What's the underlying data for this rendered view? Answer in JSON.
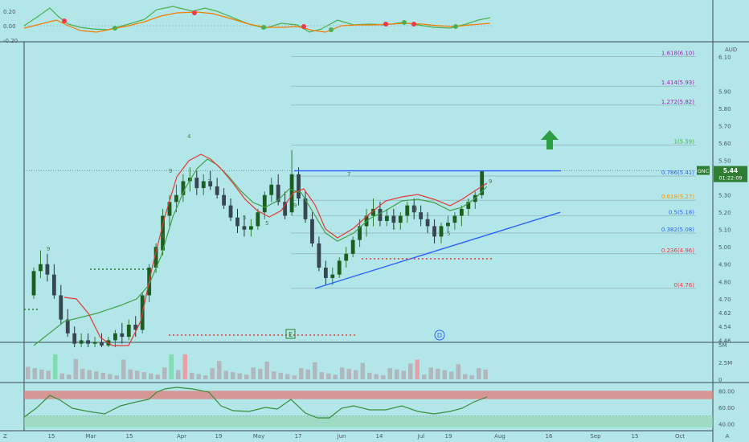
{
  "chart_data": {
    "type": "candlestick",
    "symbol": "GNC",
    "currency": "AUD",
    "last_price": "5.44",
    "countdown": "01:22:09",
    "x_ticks": [
      "15",
      "Mar",
      "15",
      "Apr",
      "19",
      "May",
      "17",
      "Jun",
      "14",
      "Jul",
      "19",
      "Aug",
      "16",
      "Sep",
      "15",
      "Oct",
      "A"
    ],
    "price_axis": {
      "ticks": [
        "6.10",
        "5.90",
        "5.80",
        "5.70",
        "5.60",
        "5.50",
        "5.40",
        "5.30",
        "5.20",
        "5.10",
        "5.00",
        "4.90",
        "4.80",
        "4.70",
        "4.62",
        "4.54",
        "4.46"
      ],
      "ylim": [
        4.42,
        6.14
      ],
      "unit": "AUD"
    },
    "fibonacci": [
      {
        "label": "1.618(6.10)",
        "price": 6.1,
        "color": "#9c27b0"
      },
      {
        "label": "1.414(5.93)",
        "price": 5.93,
        "color": "#9c27b0"
      },
      {
        "label": "1.272(5.82)",
        "price": 5.82,
        "color": "#9c27b0"
      },
      {
        "label": "1(5.59)",
        "price": 5.59,
        "color": "#4caf50"
      },
      {
        "label": "0.786(5.41)",
        "price": 5.41,
        "color": "#2962ff"
      },
      {
        "label": "0.618(5.27)",
        "price": 5.27,
        "color": "#ff9800"
      },
      {
        "label": "0.5(5.18)",
        "price": 5.18,
        "color": "#2962ff"
      },
      {
        "label": "0.382(5.08)",
        "price": 5.08,
        "color": "#2962ff"
      },
      {
        "label": "0.236(4.96)",
        "price": 4.96,
        "color": "#f23645"
      },
      {
        "label": "0(4.76)",
        "price": 4.76,
        "color": "#f23645"
      }
    ],
    "candles": [
      [
        4.72,
        4.88,
        4.7,
        4.86
      ],
      [
        4.86,
        4.98,
        4.82,
        4.9
      ],
      [
        4.9,
        4.96,
        4.8,
        4.84
      ],
      [
        4.84,
        4.9,
        4.7,
        4.72
      ],
      [
        4.72,
        4.78,
        4.55,
        4.58
      ],
      [
        4.58,
        4.64,
        4.48,
        4.5
      ],
      [
        4.5,
        4.54,
        4.42,
        4.44
      ],
      [
        4.44,
        4.5,
        4.42,
        4.46
      ],
      [
        4.46,
        4.5,
        4.42,
        4.44
      ],
      [
        4.44,
        4.48,
        4.42,
        4.45
      ],
      [
        4.45,
        4.5,
        4.42,
        4.43
      ],
      [
        4.43,
        4.48,
        4.42,
        4.46
      ],
      [
        4.46,
        4.52,
        4.42,
        4.5
      ],
      [
        4.5,
        4.56,
        4.44,
        4.48
      ],
      [
        4.48,
        4.58,
        4.46,
        4.55
      ],
      [
        4.55,
        4.6,
        4.48,
        4.52
      ],
      [
        4.52,
        4.74,
        4.5,
        4.72
      ],
      [
        4.72,
        4.9,
        4.68,
        4.88
      ],
      [
        4.88,
        5.02,
        4.85,
        5.0
      ],
      [
        4.98,
        5.22,
        4.95,
        5.18
      ],
      [
        5.18,
        5.3,
        5.12,
        5.26
      ],
      [
        5.26,
        5.36,
        5.2,
        5.3
      ],
      [
        5.3,
        5.42,
        5.26,
        5.38
      ],
      [
        5.38,
        5.46,
        5.32,
        5.4
      ],
      [
        5.4,
        5.44,
        5.3,
        5.34
      ],
      [
        5.34,
        5.42,
        5.3,
        5.38
      ],
      [
        5.38,
        5.44,
        5.33,
        5.35
      ],
      [
        5.35,
        5.4,
        5.28,
        5.3
      ],
      [
        5.3,
        5.34,
        5.22,
        5.24
      ],
      [
        5.24,
        5.28,
        5.15,
        5.17
      ],
      [
        5.17,
        5.22,
        5.08,
        5.12
      ],
      [
        5.12,
        5.18,
        5.06,
        5.1
      ],
      [
        5.1,
        5.16,
        5.06,
        5.12
      ],
      [
        5.12,
        5.22,
        5.1,
        5.2
      ],
      [
        5.2,
        5.32,
        5.16,
        5.3
      ],
      [
        5.3,
        5.4,
        5.26,
        5.36
      ],
      [
        5.36,
        5.42,
        5.24,
        5.26
      ],
      [
        5.26,
        5.32,
        5.16,
        5.18
      ],
      [
        5.2,
        5.56,
        5.18,
        5.42
      ],
      [
        5.42,
        5.46,
        5.24,
        5.28
      ],
      [
        5.28,
        5.32,
        5.14,
        5.16
      ],
      [
        5.16,
        5.2,
        5.0,
        5.02
      ],
      [
        5.02,
        5.06,
        4.86,
        4.88
      ],
      [
        4.88,
        4.92,
        4.78,
        4.82
      ],
      [
        4.82,
        4.88,
        4.78,
        4.84
      ],
      [
        4.84,
        4.94,
        4.82,
        4.92
      ],
      [
        4.92,
        5.0,
        4.88,
        4.96
      ],
      [
        4.96,
        5.06,
        4.94,
        5.04
      ],
      [
        5.04,
        5.16,
        5.0,
        5.12
      ],
      [
        5.12,
        5.22,
        5.06,
        5.18
      ],
      [
        5.18,
        5.28,
        5.12,
        5.22
      ],
      [
        5.22,
        5.26,
        5.12,
        5.15
      ],
      [
        5.15,
        5.22,
        5.12,
        5.18
      ],
      [
        5.18,
        5.22,
        5.1,
        5.14
      ],
      [
        5.14,
        5.2,
        5.1,
        5.18
      ],
      [
        5.18,
        5.26,
        5.14,
        5.24
      ],
      [
        5.24,
        5.28,
        5.16,
        5.2
      ],
      [
        5.2,
        5.24,
        5.12,
        5.16
      ],
      [
        5.16,
        5.2,
        5.08,
        5.12
      ],
      [
        5.12,
        5.16,
        5.02,
        5.06
      ],
      [
        5.06,
        5.14,
        5.02,
        5.12
      ],
      [
        5.12,
        5.18,
        5.08,
        5.14
      ],
      [
        5.14,
        5.2,
        5.1,
        5.18
      ],
      [
        5.18,
        5.24,
        5.12,
        5.22
      ],
      [
        5.22,
        5.28,
        5.18,
        5.26
      ],
      [
        5.26,
        5.32,
        5.22,
        5.3
      ],
      [
        5.3,
        5.44,
        5.28,
        5.44
      ]
    ],
    "volume": {
      "ticks": [
        "5M",
        "2.5M",
        "0"
      ],
      "ylim": [
        0,
        5.5
      ]
    },
    "rsi": {
      "ticks": [
        "80.00",
        "60.00",
        "40.00"
      ],
      "ylim": [
        32,
        88
      ],
      "upper_band": 70,
      "lower_band": 50,
      "last": 67
    }
  },
  "top_panel": {
    "ticks": [
      "0.20",
      "0.00",
      "-0.20"
    ]
  },
  "annotations": {
    "e_marker": "E",
    "d_marker": "D",
    "left_label": "Z",
    "up_arrow": "up-arrow"
  }
}
